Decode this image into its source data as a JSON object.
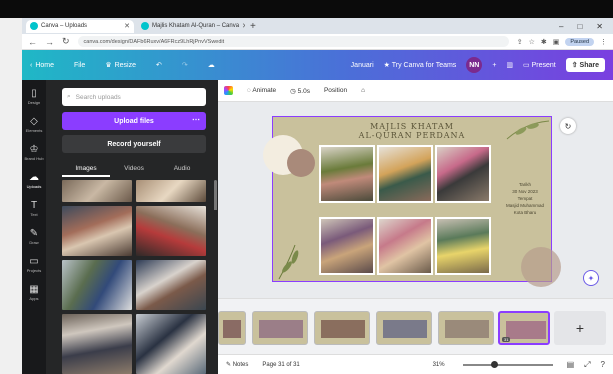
{
  "browser": {
    "tabs": [
      {
        "title": "Canva – Uploads"
      },
      {
        "title": "Majlis Khatam Al-Quran – Canva"
      }
    ],
    "url": "canva.com/design/DAFb6Ruxv/A6FRcz9LhRjPnvVSwedit",
    "window_controls": [
      "–",
      "□",
      "✕"
    ],
    "profile_label": "Paused"
  },
  "editorbar": {
    "home": "Home",
    "file": "File",
    "resize": "Resize",
    "doc_title": "Januari",
    "try_teams": "Try Canva for Teams",
    "avatar_initials": "NN",
    "present": "Present",
    "share": "Share"
  },
  "rail": [
    {
      "label": "Design",
      "icon": "layout-icon"
    },
    {
      "label": "Elements",
      "icon": "shapes-icon"
    },
    {
      "label": "Brand Hub",
      "icon": "brand-icon"
    },
    {
      "label": "Uploads",
      "icon": "upload-cloud-icon",
      "active": true
    },
    {
      "label": "Text",
      "icon": "text-icon"
    },
    {
      "label": "Draw",
      "icon": "pen-icon"
    },
    {
      "label": "Projects",
      "icon": "folder-icon"
    },
    {
      "label": "Apps",
      "icon": "apps-grid-icon"
    }
  ],
  "panel": {
    "search_placeholder": "Search uploads",
    "upload_label": "Upload files",
    "record_label": "Record yourself",
    "tabs": [
      "Images",
      "Videos",
      "Audio"
    ]
  },
  "toolbar": {
    "animate": "Animate",
    "duration": "5.0s",
    "position": "Position"
  },
  "design": {
    "title_line1": "MAJLIS KHATAM",
    "title_line2": "AL-QURAN PERDANA",
    "details": [
      "Tarikh",
      "30 Nov 2023",
      "Tempat",
      "Masjid Muhammad",
      "Kota Bharu"
    ]
  },
  "pages": {
    "current": 31,
    "total": 31,
    "label": "Page 31 of 31"
  },
  "status": {
    "notes": "Notes",
    "zoom": "31%"
  },
  "colors": {
    "accent": "#8b3dff",
    "canvas_bg": "#c9c19c"
  }
}
